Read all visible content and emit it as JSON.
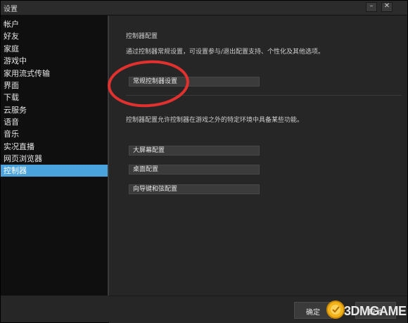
{
  "window": {
    "title": "设置",
    "minimize_glyph": "–",
    "close_glyph": "✕"
  },
  "sidebar": {
    "items": [
      {
        "label": "帐户"
      },
      {
        "label": "好友"
      },
      {
        "label": "家庭"
      },
      {
        "label": "游戏中"
      },
      {
        "label": "家用流式传输"
      },
      {
        "label": "界面"
      },
      {
        "label": "下载"
      },
      {
        "label": "云服务"
      },
      {
        "label": "语音"
      },
      {
        "label": "音乐"
      },
      {
        "label": "实况直播"
      },
      {
        "label": "网页浏览器"
      },
      {
        "label": "控制器",
        "active": true
      }
    ]
  },
  "content": {
    "heading": "控制器配置",
    "description_top": "通过控制器常规设置，可设置参与/退出配置支持、个性化及其他选项。",
    "general_button": "常规控制器设置",
    "description_bottom": "控制器配置允许控制器在游戏之外的特定环境中具备某些功能。",
    "config_buttons": [
      {
        "label": "大屏幕配置"
      },
      {
        "label": "桌面配置"
      },
      {
        "label": "向导键和弦配置"
      }
    ]
  },
  "footer": {
    "ok_label": "确定",
    "cancel_label": "取消"
  },
  "watermark": {
    "text": "3DMGAME"
  },
  "colors": {
    "active_item": "#4aa3dc",
    "highlight_ellipse": "#e0312f",
    "sidebar_bg": "#0f0f0f",
    "content_bg": "#262626"
  },
  "icons": {
    "minimize": "minimize-icon",
    "close": "close-icon",
    "watermark_logo": "coin-logo-icon"
  }
}
